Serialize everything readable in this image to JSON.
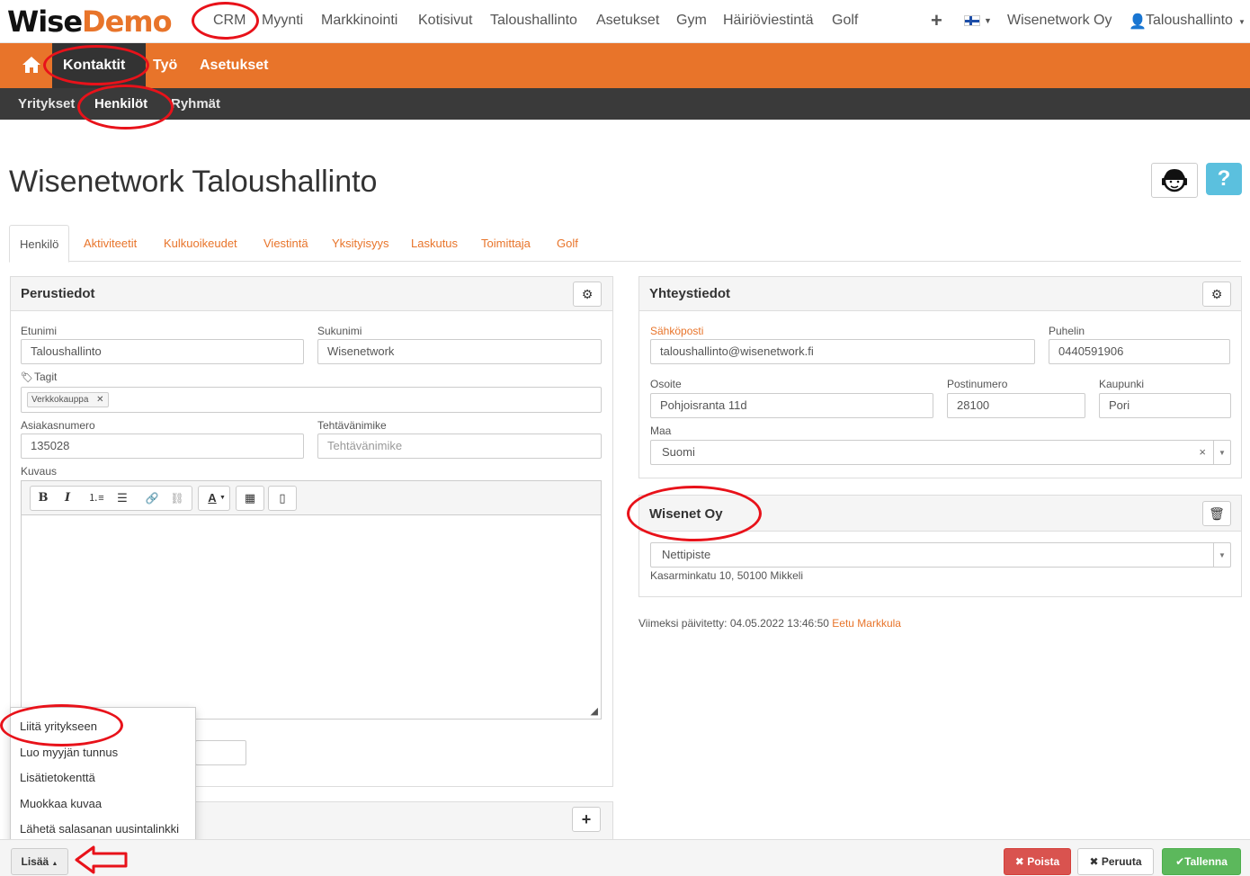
{
  "app": {
    "logo_part1": "Wise",
    "logo_part2": "Demo"
  },
  "topnav": {
    "items": [
      "CRM",
      "Myynti",
      "Markkinointi",
      "Kotisivut",
      "Taloushallinto",
      "Asetukset",
      "Gym",
      "Häiriöviestintä",
      "Golf"
    ],
    "company": "Wisenetwork Oy",
    "user": "Taloushallinto",
    "plus_icon": "+",
    "flag_icon": "finnish-flag-icon"
  },
  "orangebar": {
    "items": [
      "Kontaktit",
      "Työ",
      "Asetukset"
    ]
  },
  "darkbar": {
    "items": [
      "Yritykset",
      "Henkilöt",
      "Ryhmät"
    ]
  },
  "page": {
    "title": "Wisenetwork Taloushallinto",
    "help_label": "?"
  },
  "tabs": [
    "Henkilö",
    "Aktiviteetit",
    "Kulkuoikeudet",
    "Viestintä",
    "Yksityisyys",
    "Laskutus",
    "Toimittaja",
    "Golf"
  ],
  "basic_info": {
    "title": "Perustiedot",
    "first_name_label": "Etunimi",
    "first_name_value": "Taloushallinto",
    "last_name_label": "Sukunimi",
    "last_name_value": "Wisenetwork",
    "tags_label": "Tagit",
    "tag_value": "Verkkokauppa",
    "customer_no_label": "Asiakasnumero",
    "customer_no_value": "135028",
    "job_title_label": "Tehtävänimike",
    "job_title_placeholder": "Tehtävänimike",
    "description_label": "Kuvaus"
  },
  "contact_info": {
    "title": "Yhteystiedot",
    "email_label": "Sähköposti",
    "email_value": "taloushallinto@wisenetwork.fi",
    "phone_label": "Puhelin",
    "phone_value": "0440591906",
    "address_label": "Osoite",
    "address_value": "Pohjoisranta 11d",
    "postal_label": "Postinumero",
    "postal_value": "28100",
    "city_label": "Kaupunki",
    "city_value": "Pori",
    "country_label": "Maa",
    "country_value": "Suomi"
  },
  "company_panel": {
    "title": "Wisenet Oy",
    "office_value": "Nettipiste",
    "address": "Kasarminkatu 10, 50100 Mikkeli"
  },
  "updated": {
    "prefix": "Viimeksi päivitetty: 04.05.2022 13:46:50",
    "user": "Eetu Markkula"
  },
  "dropdown": {
    "items": [
      "Liitä yritykseen",
      "Luo myyjän tunnus",
      "Lisätietokenttä",
      "Muokkaa kuvaa",
      "Lähetä salasanan uusintalinkki"
    ]
  },
  "footer": {
    "more_label": "Lisää",
    "delete_label": "Poista",
    "cancel_label": "Peruuta",
    "save_label": "Tallenna"
  },
  "colors": {
    "accent": "#e8742a",
    "dark": "#3a3a3a",
    "highlight": "#e8121a"
  }
}
